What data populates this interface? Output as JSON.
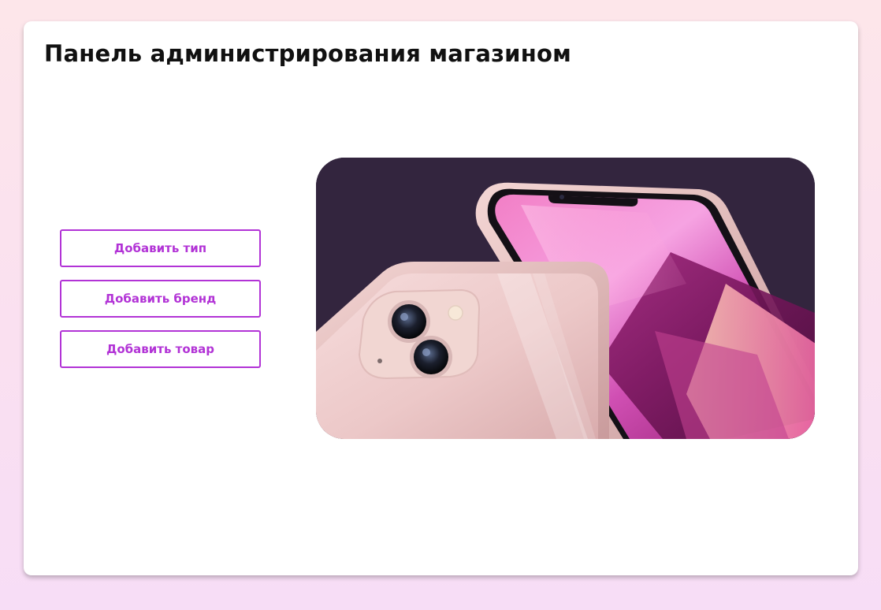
{
  "page": {
    "title": "Панель администрирования магазином"
  },
  "actions": [
    {
      "label": "Добавить тип"
    },
    {
      "label": "Добавить  бренд"
    },
    {
      "label": "Добавить  товар"
    }
  ],
  "hero": {
    "image": "pink-smartphone-product-image",
    "background_color": "#33253e"
  },
  "colors": {
    "accent": "#b233d6",
    "panel": "#ffffff",
    "page_background": "#fae0f0"
  }
}
